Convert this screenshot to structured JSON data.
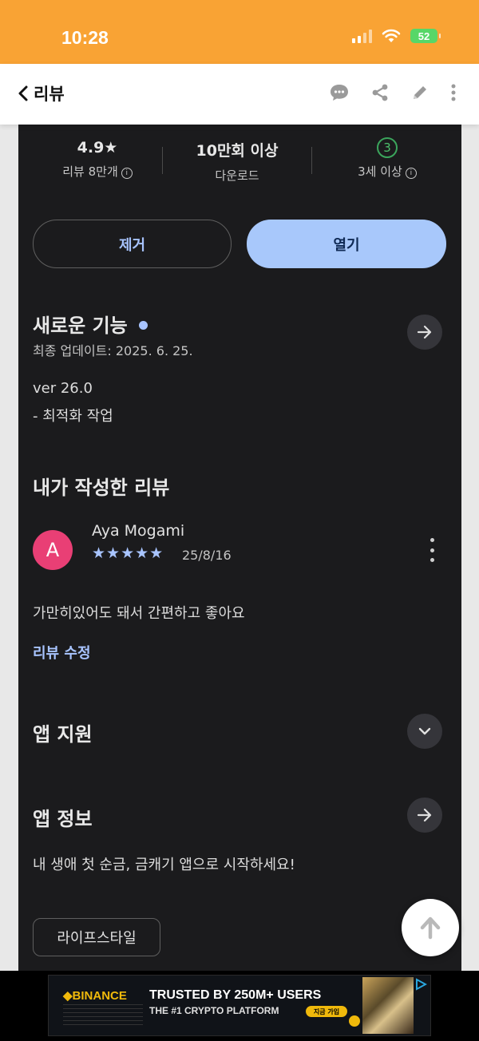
{
  "status_bar": {
    "time": "10:28",
    "battery": "52"
  },
  "nav": {
    "back_label": "리뷰",
    "icons": [
      "comment-icon",
      "share-icon",
      "pencil-icon",
      "more-icon"
    ]
  },
  "stats": [
    {
      "value": "4.9★",
      "label": "리뷰 8만개"
    },
    {
      "value": "10만회 이상",
      "label": "다운로드"
    },
    {
      "value": "3",
      "label": "3세 이상"
    }
  ],
  "actions": {
    "remove": "제거",
    "open": "열기"
  },
  "whats_new": {
    "title": "새로운 기능",
    "updated": "최종 업데이트: 2025. 6. 25.",
    "version": "ver 26.0",
    "note": "- 최적화 작업"
  },
  "my_review": {
    "title": "내가 작성한 리뷰",
    "avatar_letter": "A",
    "author": "Aya Mogami",
    "stars": "★★★★★",
    "rating": 5,
    "date": "25/8/16",
    "body": "가만히있어도 돼서 간편하고 좋아요",
    "edit": "리뷰 수정"
  },
  "support": {
    "title": "앱 지원"
  },
  "about": {
    "title": "앱 정보",
    "description": "내 생애 첫 순금, 금캐기 앱으로 시작하세요!",
    "category": "라이프스타일"
  },
  "ad": {
    "brand": "◆BINANCE",
    "headline": "TRUSTED BY 250M+ USERS",
    "subline": "THE #1 CRYPTO PLATFORM",
    "cta": "지금 가입"
  },
  "colors": {
    "status_bar": "#f9a334",
    "app_bg": "#1b1b1d",
    "accent": "#a8c4ff",
    "open_button": "#a8c8fb",
    "avatar": "#e93f75",
    "age_badge": "#3ba55c"
  }
}
